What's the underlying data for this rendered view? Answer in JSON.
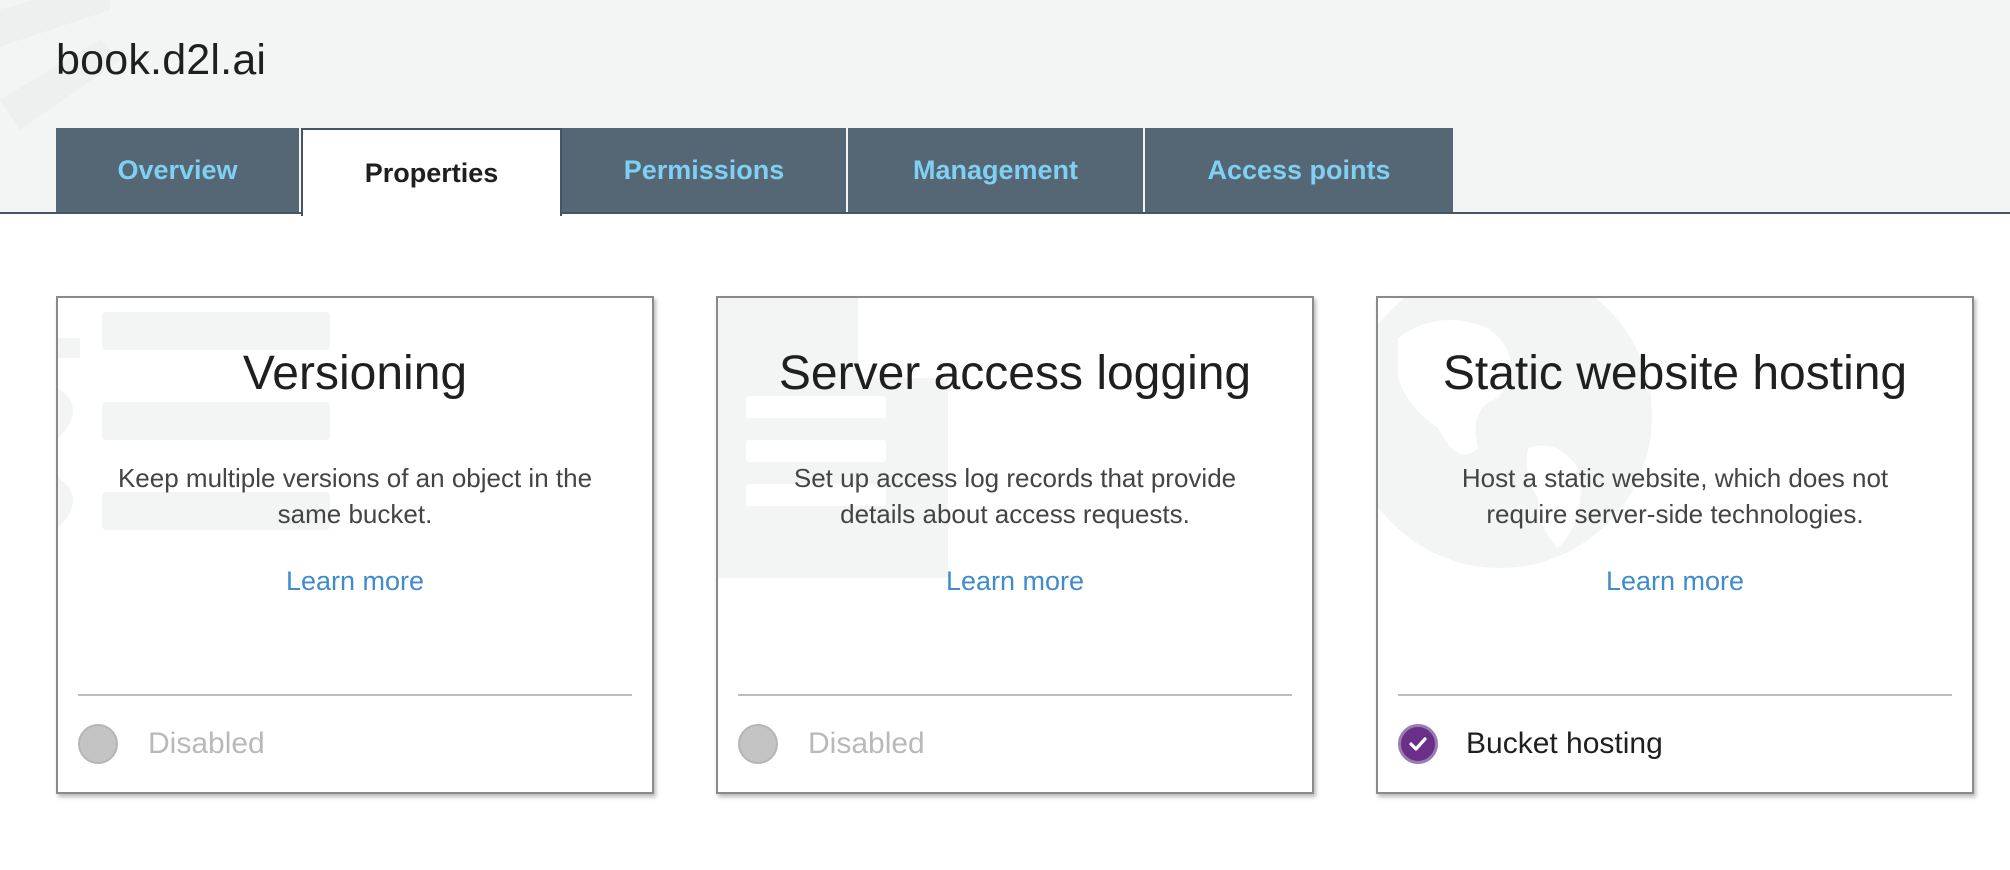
{
  "header": {
    "bucket_name": "book.d2l.ai"
  },
  "tabs": [
    {
      "label": "Overview",
      "active": false
    },
    {
      "label": "Properties",
      "active": true
    },
    {
      "label": "Permissions",
      "active": false
    },
    {
      "label": "Management",
      "active": false
    },
    {
      "label": "Access points",
      "active": false
    }
  ],
  "cards": [
    {
      "title": "Versioning",
      "description": "Keep multiple versions of an object in the same bucket.",
      "learn_more": "Learn more",
      "status": "Disabled",
      "enabled": false
    },
    {
      "title": "Server access logging",
      "description": "Set up access log records that provide details about access requests.",
      "learn_more": "Learn more",
      "status": "Disabled",
      "enabled": false
    },
    {
      "title": "Static website hosting",
      "description": "Host a static website, which does not require server-side technologies.",
      "learn_more": "Learn more",
      "status": "Bucket hosting",
      "enabled": true
    }
  ],
  "colors": {
    "tab_bg": "#556675",
    "tab_text": "#7fd0f2",
    "link": "#3f8ccc",
    "enabled_check": "#6a2f86",
    "disabled_dot": "#c4c4c4"
  },
  "icons": {
    "versioning_art": "stacked-layers-icon",
    "logging_art": "document-icon",
    "hosting_art": "globe-icon",
    "enabled": "check-circle-icon",
    "disabled": "empty-circle-icon"
  }
}
